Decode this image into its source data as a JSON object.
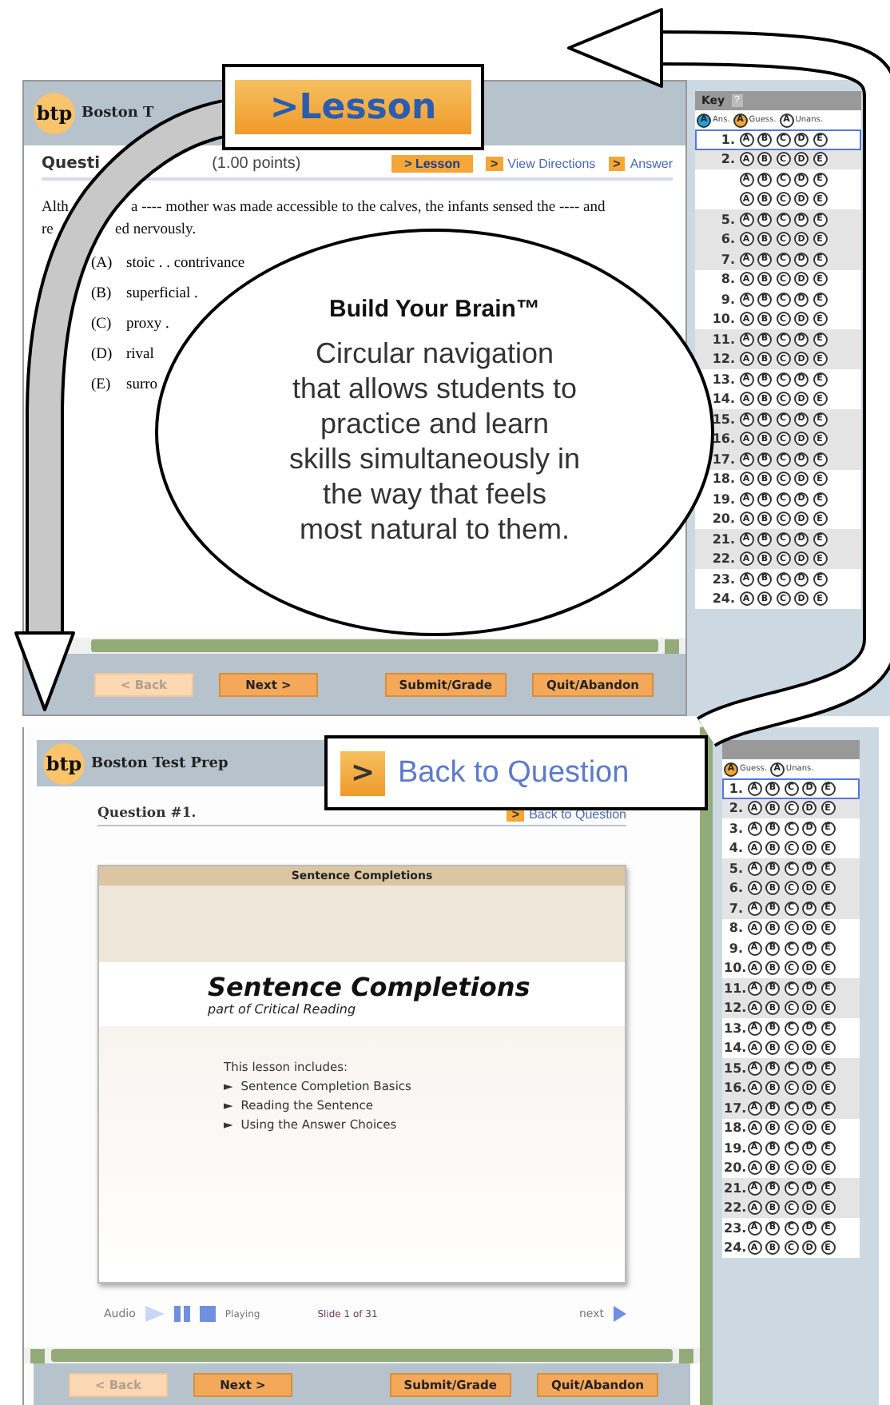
{
  "top_screen": {
    "logo": "btp",
    "brand": "Boston T",
    "question_label": "Questi",
    "points": "(1.00 points)",
    "links": [
      {
        "kind": "tag",
        "marker": ">",
        "label": "Lesson"
      },
      {
        "kind": "link",
        "marker": ">",
        "label": "View Directions"
      },
      {
        "kind": "link",
        "marker": ">",
        "label": "Answer"
      }
    ],
    "question_lines": [
      [
        "Alth",
        "a ---- mother was made accessible to the calves, the infants sensed the ---- and"
      ],
      [
        "re",
        "ed nervously."
      ]
    ],
    "choices": [
      {
        "letter": "(A)",
        "text": "stoic . . contrivance"
      },
      {
        "letter": "(B)",
        "text": "superficial ."
      },
      {
        "letter": "(C)",
        "text": "proxy ."
      },
      {
        "letter": "(D)",
        "text": "rival"
      },
      {
        "letter": "(E)",
        "text": "surro"
      }
    ],
    "buttons": [
      {
        "label": "< Back",
        "disabled": true,
        "kind": "nav"
      },
      {
        "label": "Next >",
        "disabled": false,
        "kind": "nav"
      },
      {
        "label": "Submit/Grade",
        "disabled": false,
        "kind": "action"
      },
      {
        "label": "Quit/Abandon",
        "disabled": false,
        "kind": "action"
      }
    ]
  },
  "top_sheet": {
    "title": "Key",
    "help": "?",
    "legend": [
      {
        "kind": "answered",
        "bubble": "A",
        "label": "Ans."
      },
      {
        "kind": "guess",
        "bubble": "A",
        "label": "Guess."
      },
      {
        "kind": "unanswered",
        "bubble": "A",
        "label": "Unans."
      }
    ],
    "rows": [
      {
        "number": "1.",
        "shaded": false,
        "selected": true,
        "bubbles": [
          "A",
          "B",
          "C",
          "D",
          "E"
        ]
      },
      {
        "number": "2.",
        "shaded": true,
        "selected": false,
        "bubbles": [
          "A",
          "B",
          "C",
          "D",
          "E"
        ]
      },
      {
        "shaded": false,
        "selected": false,
        "bubbles": [
          "A",
          "B",
          "C",
          "D",
          "E"
        ]
      },
      {
        "shaded": false,
        "selected": false,
        "bubbles": [
          "A",
          "B",
          "C",
          "D",
          "E"
        ]
      },
      {
        "number": "5.",
        "shaded": true,
        "selected": false,
        "bubbles": [
          "A",
          "B",
          "C",
          "D",
          "E"
        ]
      },
      {
        "number": "6.",
        "shaded": true,
        "selected": false,
        "bubbles": [
          "A",
          "B",
          "C",
          "D",
          "E"
        ]
      },
      {
        "number": "7.",
        "shaded": true,
        "selected": false,
        "bubbles": [
          "A",
          "B",
          "C",
          "D",
          "E"
        ]
      },
      {
        "number": "8.",
        "shaded": false,
        "selected": false,
        "bubbles": [
          "A",
          "B",
          "C",
          "D",
          "E"
        ]
      },
      {
        "number": "9.",
        "shaded": false,
        "selected": false,
        "bubbles": [
          "A",
          "B",
          "C",
          "D",
          "E"
        ]
      },
      {
        "number": "10.",
        "shaded": false,
        "selected": false,
        "bubbles": [
          "A",
          "B",
          "C",
          "D",
          "E"
        ]
      },
      {
        "number": "11.",
        "shaded": true,
        "selected": false,
        "bubbles": [
          "A",
          "B",
          "C",
          "D",
          "E"
        ]
      },
      {
        "number": "12.",
        "shaded": true,
        "selected": false,
        "bubbles": [
          "A",
          "B",
          "C",
          "D",
          "E"
        ]
      },
      {
        "number": "13.",
        "shaded": false,
        "selected": false,
        "bubbles": [
          "A",
          "B",
          "C",
          "D",
          "E"
        ]
      },
      {
        "number": "14.",
        "shaded": false,
        "selected": false,
        "bubbles": [
          "A",
          "B",
          "C",
          "D",
          "E"
        ]
      },
      {
        "number": "15.",
        "shaded": true,
        "selected": false,
        "bubbles": [
          "A",
          "B",
          "C",
          "D",
          "E"
        ]
      },
      {
        "number": "16.",
        "shaded": true,
        "selected": false,
        "bubbles": [
          "A",
          "B",
          "C",
          "D",
          "E"
        ]
      },
      {
        "number": "17.",
        "shaded": true,
        "selected": false,
        "bubbles": [
          "A",
          "B",
          "C",
          "D",
          "E"
        ]
      },
      {
        "number": "18.",
        "shaded": false,
        "selected": false,
        "bubbles": [
          "A",
          "B",
          "C",
          "D",
          "E"
        ]
      },
      {
        "number": "19.",
        "shaded": false,
        "selected": false,
        "bubbles": [
          "A",
          "B",
          "C",
          "D",
          "E"
        ]
      },
      {
        "number": "20.",
        "shaded": false,
        "selected": false,
        "bubbles": [
          "A",
          "B",
          "C",
          "D",
          "E"
        ]
      },
      {
        "number": "21.",
        "shaded": true,
        "selected": false,
        "bubbles": [
          "A",
          "B",
          "C",
          "D",
          "E"
        ]
      },
      {
        "number": "22.",
        "shaded": true,
        "selected": false,
        "bubbles": [
          "A",
          "B",
          "C",
          "D",
          "E"
        ]
      },
      {
        "number": "23.",
        "shaded": false,
        "selected": false,
        "bubbles": [
          "A",
          "B",
          "C",
          "D",
          "E"
        ]
      },
      {
        "number": "24.",
        "shaded": false,
        "selected": false,
        "bubbles": [
          "A",
          "B",
          "C",
          "D",
          "E"
        ]
      }
    ]
  },
  "bottom_screen": {
    "logo": "btp",
    "brand": "Boston Test Prep",
    "question_label": "Question #1.",
    "link": {
      "marker": ">",
      "label": "Back to Question"
    },
    "slide": {
      "header": "Sentence Completions",
      "title": "Sentence Completions",
      "subtitle": "part of Critical Reading",
      "intro": "This lesson includes:",
      "bullet": "►",
      "items": [
        "Sentence Completion Basics",
        "Reading the Sentence",
        "Using the Answer Choices"
      ]
    },
    "audio": {
      "label": "Audio",
      "status": "Playing",
      "counter": "Slide 1 of 31",
      "next": "next"
    },
    "buttons": [
      {
        "label": "< Back",
        "disabled": true,
        "kind": "nav"
      },
      {
        "label": "Next >",
        "disabled": false,
        "kind": "nav"
      },
      {
        "label": "Submit/Grade",
        "disabled": false,
        "kind": "action"
      },
      {
        "label": "Quit/Abandon",
        "disabled": false,
        "kind": "action"
      }
    ]
  },
  "bottom_sheet": {
    "legend": [
      {
        "kind": "guess",
        "bubble": "A",
        "label": "Guess."
      },
      {
        "kind": "unanswered",
        "bubble": "A",
        "label": "Unans."
      }
    ],
    "rows": [
      {
        "number": "1.",
        "shaded": false,
        "selected": true,
        "bubbles": [
          "A",
          "B",
          "C",
          "D",
          "E"
        ]
      },
      {
        "number": "2.",
        "shaded": true,
        "selected": false,
        "bubbles": [
          "A",
          "B",
          "C",
          "D",
          "E"
        ]
      },
      {
        "number": "3.",
        "shaded": false,
        "selected": false,
        "bubbles": [
          "A",
          "B",
          "C",
          "D",
          "E"
        ]
      },
      {
        "number": "4.",
        "shaded": false,
        "selected": false,
        "bubbles": [
          "A",
          "B",
          "C",
          "D",
          "E"
        ]
      },
      {
        "number": "5.",
        "shaded": true,
        "selected": false,
        "bubbles": [
          "A",
          "B",
          "C",
          "D",
          "E"
        ]
      },
      {
        "number": "6.",
        "shaded": true,
        "selected": false,
        "bubbles": [
          "A",
          "B",
          "C",
          "D",
          "E"
        ]
      },
      {
        "number": "7.",
        "shaded": true,
        "selected": false,
        "bubbles": [
          "A",
          "B",
          "C",
          "D",
          "E"
        ]
      },
      {
        "number": "8.",
        "shaded": false,
        "selected": false,
        "bubbles": [
          "A",
          "B",
          "C",
          "D",
          "E"
        ]
      },
      {
        "number": "9.",
        "shaded": false,
        "selected": false,
        "bubbles": [
          "A",
          "B",
          "C",
          "D",
          "E"
        ]
      },
      {
        "number": "10.",
        "shaded": false,
        "selected": false,
        "bubbles": [
          "A",
          "B",
          "C",
          "D",
          "E"
        ]
      },
      {
        "number": "11.",
        "shaded": true,
        "selected": false,
        "bubbles": [
          "A",
          "B",
          "C",
          "D",
          "E"
        ]
      },
      {
        "number": "12.",
        "shaded": true,
        "selected": false,
        "bubbles": [
          "A",
          "B",
          "C",
          "D",
          "E"
        ]
      },
      {
        "number": "13.",
        "shaded": false,
        "selected": false,
        "bubbles": [
          "A",
          "B",
          "C",
          "D",
          "E"
        ]
      },
      {
        "number": "14.",
        "shaded": false,
        "selected": false,
        "bubbles": [
          "A",
          "B",
          "C",
          "D",
          "E"
        ]
      },
      {
        "number": "15.",
        "shaded": true,
        "selected": false,
        "bubbles": [
          "A",
          "B",
          "C",
          "D",
          "E"
        ]
      },
      {
        "number": "16.",
        "shaded": true,
        "selected": false,
        "bubbles": [
          "A",
          "B",
          "C",
          "D",
          "E"
        ]
      },
      {
        "number": "17.",
        "shaded": true,
        "selected": false,
        "bubbles": [
          "A",
          "B",
          "C",
          "D",
          "E"
        ]
      },
      {
        "number": "18.",
        "shaded": false,
        "selected": false,
        "bubbles": [
          "A",
          "B",
          "C",
          "D",
          "E"
        ]
      },
      {
        "number": "19.",
        "shaded": false,
        "selected": false,
        "bubbles": [
          "A",
          "B",
          "C",
          "D",
          "E"
        ]
      },
      {
        "number": "20.",
        "shaded": false,
        "selected": false,
        "bubbles": [
          "A",
          "B",
          "C",
          "D",
          "E"
        ]
      },
      {
        "number": "21.",
        "shaded": true,
        "selected": false,
        "bubbles": [
          "A",
          "B",
          "C",
          "D",
          "E"
        ]
      },
      {
        "number": "22.",
        "shaded": true,
        "selected": false,
        "bubbles": [
          "A",
          "B",
          "C",
          "D",
          "E"
        ]
      },
      {
        "number": "23.",
        "shaded": false,
        "selected": false,
        "bubbles": [
          "A",
          "B",
          "C",
          "D",
          "E"
        ]
      },
      {
        "number": "24.",
        "shaded": false,
        "selected": false,
        "bubbles": [
          "A",
          "B",
          "C",
          "D",
          "E"
        ]
      }
    ]
  },
  "lesson_callout": {
    "marker": ">",
    "label": "Lesson"
  },
  "bubble": {
    "title": "Build Your Brain™",
    "text": "Circular navigation\nthat allows students to\npractice and learn\nskills simultaneously in\nthe way that feels\nmost natural to them."
  },
  "question_callout": {
    "marker": ">",
    "label": "Back to Question"
  }
}
